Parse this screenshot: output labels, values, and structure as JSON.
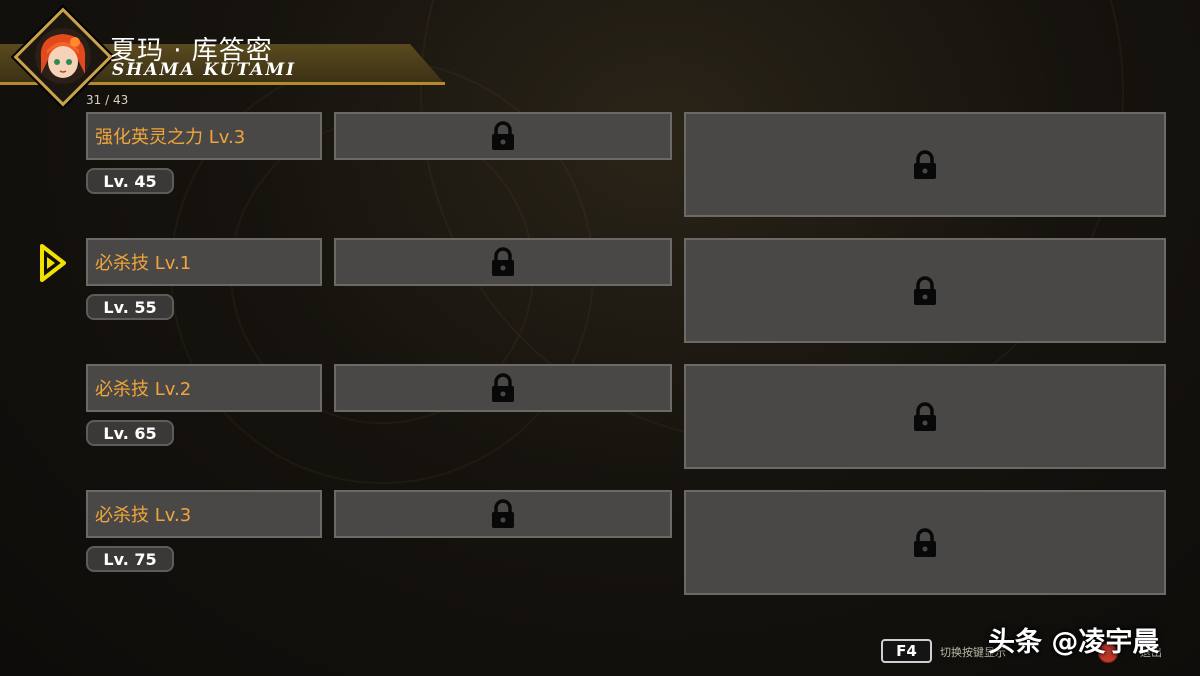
{
  "character": {
    "name_cn": "夏玛 · 库答密",
    "name_en": "SHAMA KUTAMI"
  },
  "counter": "31 / 43",
  "skills": [
    {
      "name": "强化英灵之力 Lv.3",
      "level": "Lv. 45"
    },
    {
      "name": "必杀技 Lv.1",
      "level": "Lv. 55"
    },
    {
      "name": "必杀技 Lv.2",
      "level": "Lv. 65"
    },
    {
      "name": "必杀技 Lv.3",
      "level": "Lv. 75"
    }
  ],
  "footer": {
    "key": "F4",
    "hint": "切换按键显示",
    "exit": "退出"
  },
  "watermark": "头条 @凌宇晨",
  "colors": {
    "skill_text": "#f0a53a",
    "accent_gold": "#c9a24a",
    "cursor_yellow": "#f2e000"
  },
  "icons": [
    "lock-icon",
    "cursor-arrow-icon",
    "character-portrait"
  ]
}
